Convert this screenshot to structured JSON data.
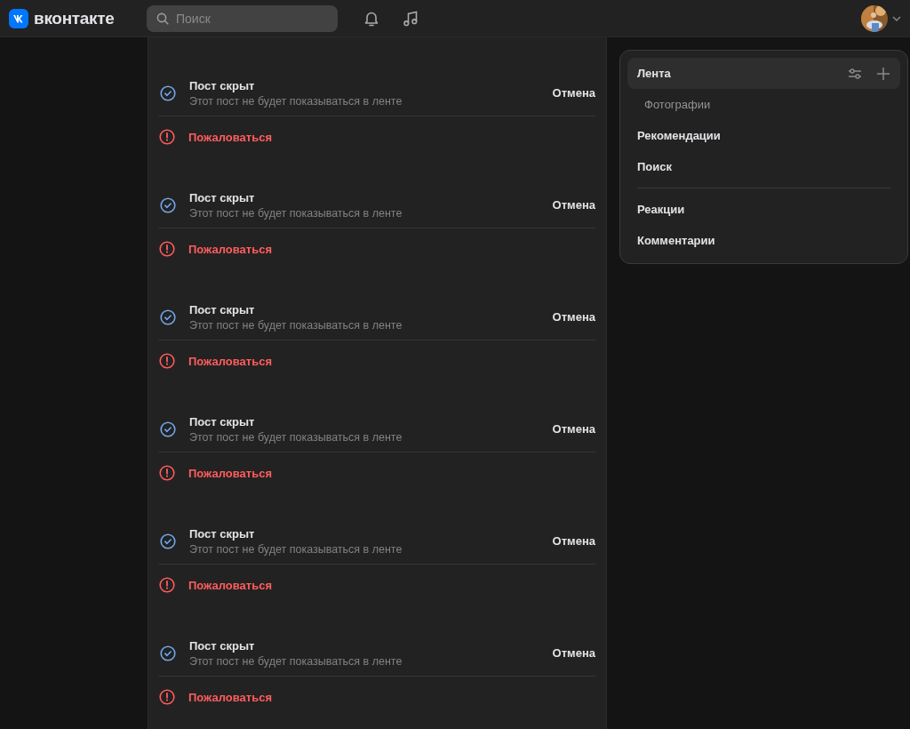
{
  "header": {
    "logo_text": "вконтакте",
    "search": {
      "placeholder": "Поиск"
    }
  },
  "posts": [
    {
      "title": "Пост скрыт",
      "subtitle": "Этот пост не будет показываться в ленте",
      "action": "Отмена",
      "report": "Пожаловаться"
    },
    {
      "title": "Пост скрыт",
      "subtitle": "Этот пост не будет показываться в ленте",
      "action": "Отмена",
      "report": "Пожаловаться"
    },
    {
      "title": "Пост скрыт",
      "subtitle": "Этот пост не будет показываться в ленте",
      "action": "Отмена",
      "report": "Пожаловаться"
    },
    {
      "title": "Пост скрыт",
      "subtitle": "Этот пост не будет показываться в ленте",
      "action": "Отмена",
      "report": "Пожаловаться"
    },
    {
      "title": "Пост скрыт",
      "subtitle": "Этот пост не будет показываться в ленте",
      "action": "Отмена",
      "report": "Пожаловаться"
    },
    {
      "title": "Пост скрыт",
      "subtitle": "Этот пост не будет показываться в ленте",
      "action": "Отмена",
      "report": "Пожаловаться"
    }
  ],
  "menu": {
    "groups": [
      [
        {
          "label": "Лента",
          "selected": true,
          "children": [
            {
              "label": "Фотографии",
              "selected": false
            }
          ]
        },
        {
          "label": "Рекомендации",
          "selected": false
        },
        {
          "label": "Поиск",
          "selected": false
        }
      ],
      [
        {
          "label": "Реакции",
          "selected": false
        },
        {
          "label": "Комментарии",
          "selected": false
        }
      ]
    ]
  }
}
